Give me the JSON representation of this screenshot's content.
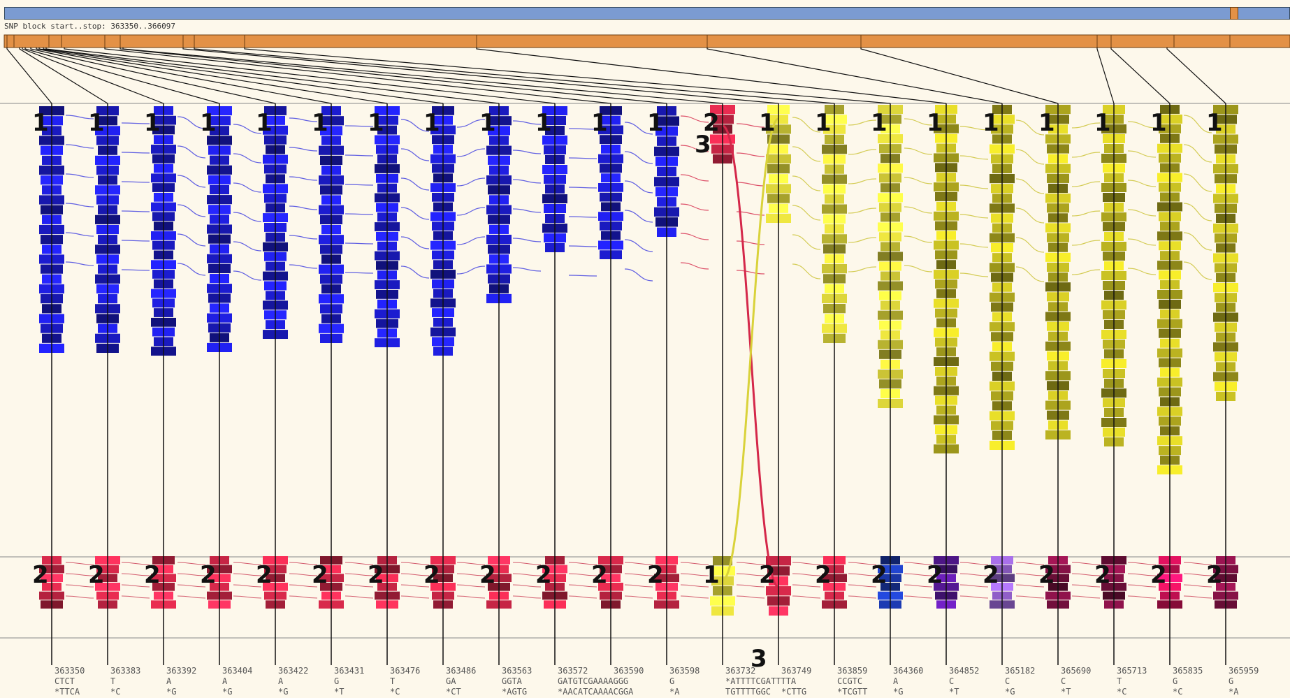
{
  "block_label": "SNP block start..stop: 363350..366097",
  "colors": {
    "background": "#fdf8eb",
    "overview_bar": "#7b9bd1",
    "block_segment": "#e39146",
    "haplotype1_blue": "#1c1ccd",
    "haplotype1_yellow": "#d9d23a",
    "haplotype2_red": "#d4284a",
    "haplotype2_magenta": "#7a1040"
  },
  "snps": [
    {
      "pos": "363350",
      "ref": "CTCT",
      "alt": "*TTCA",
      "top": "1",
      "bottom": "2"
    },
    {
      "pos": "363383",
      "ref": "T",
      "alt": "*C",
      "top": "1",
      "bottom": "2"
    },
    {
      "pos": "363392",
      "ref": "A",
      "alt": "*G",
      "top": "1",
      "bottom": "2"
    },
    {
      "pos": "363404",
      "ref": "A",
      "alt": "*G",
      "top": "1",
      "bottom": "2"
    },
    {
      "pos": "363422",
      "ref": "A",
      "alt": "*G",
      "top": "1",
      "bottom": "2"
    },
    {
      "pos": "363431",
      "ref": "G",
      "alt": "*T",
      "top": "1",
      "bottom": "2"
    },
    {
      "pos": "363476",
      "ref": "T",
      "alt": "*C",
      "top": "1",
      "bottom": "2"
    },
    {
      "pos": "363486",
      "ref": "GA",
      "alt": "*CT",
      "top": "1",
      "bottom": "2"
    },
    {
      "pos": "363563",
      "ref": "GGTA",
      "alt": "*AGTG",
      "top": "1",
      "bottom": "2"
    },
    {
      "pos": "363572",
      "ref": "GATGTCGAAAAGGG",
      "alt": "*AACATCAAAACGGA",
      "top": "1",
      "bottom": "2"
    },
    {
      "pos": "363590",
      "ref": "",
      "alt": "",
      "top": "1",
      "bottom": "2"
    },
    {
      "pos": "363598",
      "ref": "G",
      "alt": "*A",
      "top": "1",
      "bottom": "2"
    },
    {
      "pos": "363732",
      "ref": "*ATTTTCGATTTTA",
      "alt": "TGTTTTGGC",
      "top": "2",
      "bottom": "1"
    },
    {
      "pos": "363749",
      "ref": "",
      "alt": "*CTTG",
      "top": "1",
      "bottom": "2"
    },
    {
      "pos": "363859",
      "ref": "CCGTC",
      "alt": "*TCGTT",
      "top": "1",
      "bottom": "2"
    },
    {
      "pos": "364360",
      "ref": "A",
      "alt": "*G",
      "top": "1",
      "bottom": "2"
    },
    {
      "pos": "364852",
      "ref": "C",
      "alt": "*T",
      "top": "1",
      "bottom": "2"
    },
    {
      "pos": "365182",
      "ref": "C",
      "alt": "*G",
      "top": "1",
      "bottom": "2"
    },
    {
      "pos": "365690",
      "ref": "C",
      "alt": "*T",
      "top": "1",
      "bottom": "2"
    },
    {
      "pos": "365713",
      "ref": "T",
      "alt": "*C",
      "top": "1",
      "bottom": "2"
    },
    {
      "pos": "365835",
      "ref": "G",
      "alt": "*C",
      "top": "1",
      "bottom": "2"
    },
    {
      "pos": "365959",
      "ref": "G",
      "alt": "*A",
      "top": "1",
      "bottom": "2"
    }
  ],
  "extra_labels": [
    "3",
    "3"
  ]
}
